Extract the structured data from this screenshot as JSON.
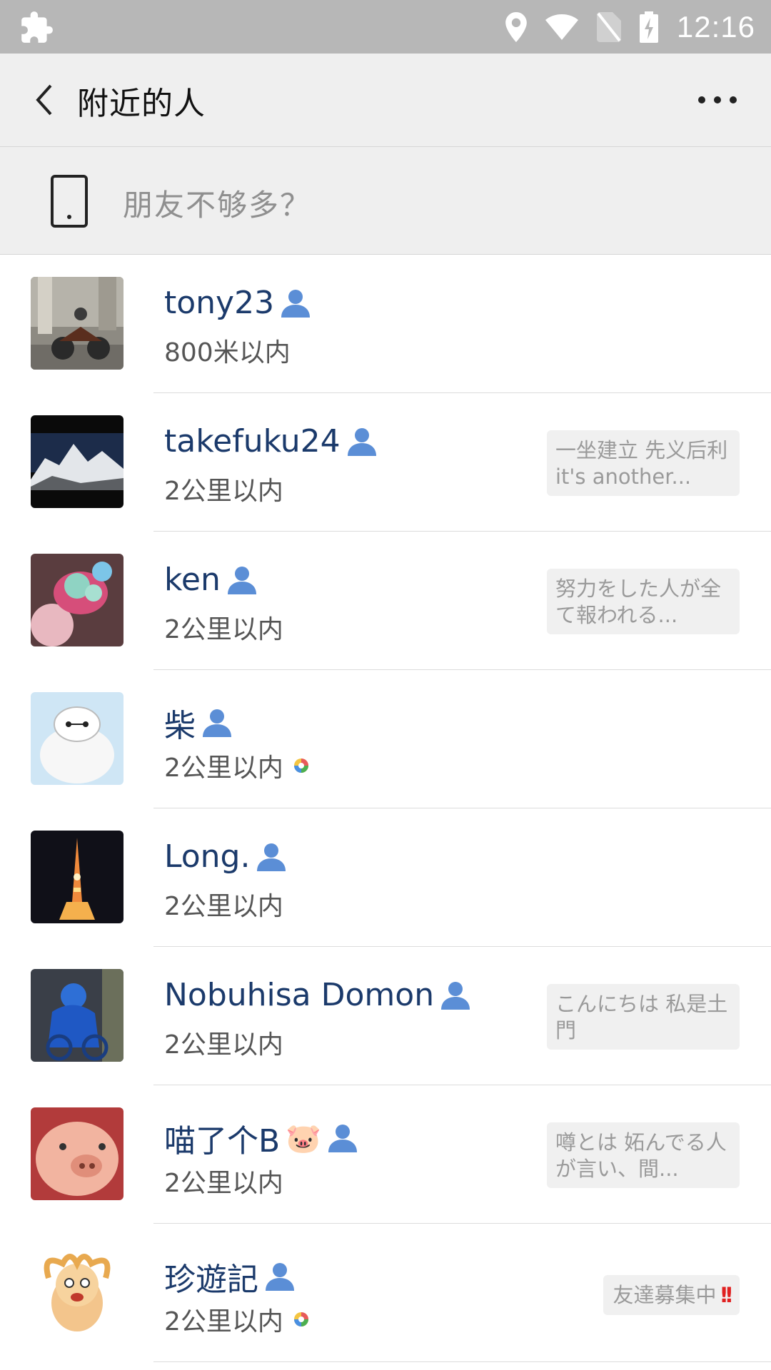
{
  "status_bar": {
    "time": "12:16",
    "icons": [
      "puzzle-icon",
      "location-icon",
      "wifi-icon",
      "no-sim-icon",
      "battery-charging-icon"
    ]
  },
  "header": {
    "title": "附近的人",
    "back_icon": "chevron-left-icon",
    "more_icon": "more-dots-icon"
  },
  "promo": {
    "text": "朋友不够多？",
    "icon": "phone-icon"
  },
  "people": [
    {
      "name": "tony23",
      "distance": "800米以内",
      "signature": "",
      "moments": false
    },
    {
      "name": "takefuku24",
      "distance": "2公里以内",
      "signature": "一坐建立 先义后利 it's another...",
      "moments": false
    },
    {
      "name": "ken",
      "distance": "2公里以内",
      "signature": "努力をした人が全て報われる...",
      "moments": false
    },
    {
      "name": "柴",
      "distance": "2公里以内",
      "signature": "",
      "moments": true
    },
    {
      "name": "Long.",
      "distance": "2公里以内",
      "signature": "",
      "moments": false
    },
    {
      "name": "Nobuhisa Domon",
      "distance": "2公里以内",
      "signature": "こんにちは 私是土門",
      "moments": false
    },
    {
      "name": "喵了个B",
      "name_emoji": "🐷",
      "distance": "2公里以内",
      "signature": "噂とは 妬んでる人が言い、間...",
      "moments": false
    },
    {
      "name": "珍遊記",
      "distance": "2公里以内",
      "signature": "友達募集中",
      "signature_suffix": "!!",
      "moments": true
    }
  ],
  "colors": {
    "name": "#1b3a6b",
    "person_icon": "#5b8ed6",
    "header_bg": "#efefef",
    "status_bar_bg": "#b7b7b7"
  }
}
